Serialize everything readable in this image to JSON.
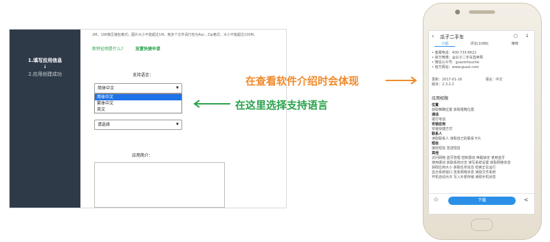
{
  "sidebar": {
    "step1": "1.填写应用信息",
    "step_arrow": "↓",
    "step2": "2.应用创建成功"
  },
  "form": {
    "hint": "2M，196像压缩包格式；图片大小不能超过1M，格多个文件请打包为Rar，Zip格式，大小不能超过100M。",
    "link_what": "新特征明是什么?",
    "link_template": "放置快捷申请",
    "support_lang_label": "支持语言：",
    "lang_select_value": "简体中文",
    "lang_options": [
      "简体中文",
      "繁体中文",
      "英文"
    ],
    "category_select_value": "请选择",
    "intro_label": "应用简介："
  },
  "callouts": {
    "right_text": "在查看软件介绍时会体现",
    "left_text": "在这里选择支持语言",
    "orange": "#f08a2c",
    "green": "#2aa24c"
  },
  "phone": {
    "title": "瓜子二手车",
    "tabs": [
      "介绍",
      "评论(1086)",
      "推荐"
    ],
    "contacts": [
      "• 客服电话：400-733-6622",
      "• 官方微博：@瓜子二手车直卖网",
      "• 微信公众号：guazishouche",
      "• 官方网站：www.guazi.com"
    ],
    "update_label": "更新：2017-01-16",
    "lang_label": "语言：中文",
    "version_label": "版本：2.3.2.2",
    "permissions_title": "应用权限",
    "perm_groups": [
      {
        "name": "位置",
        "items": "获取精确位置  获取粗略位置"
      },
      {
        "name": "通话",
        "items": "拨打电话"
      },
      {
        "name": "安装应用",
        "items": "安装快捷方式"
      },
      {
        "name": "联系人",
        "items": "读取联系人  读取自己的联系卡片"
      },
      {
        "name": "短信",
        "items": "接收短信  发送短信"
      },
      {
        "name": "其他",
        "items": "访问网络  蓝牙管理  控制振动  唤醒锁定  使用蓝牙"
      },
      {
        "name": "",
        "items": "使用振动  获取系统日志  读写系统设置  获取网络状态"
      },
      {
        "name": "",
        "items": "获取应用大小  获取任务信息  检索正在运行"
      },
      {
        "name": "",
        "items": "显示系统窗口  改变网络状态  读取文件系统"
      },
      {
        "name": "",
        "items": "开机自动允许  写入外部存储  读取手机状态"
      }
    ],
    "download_label": "下载",
    "accent": "#2b8fe8"
  }
}
